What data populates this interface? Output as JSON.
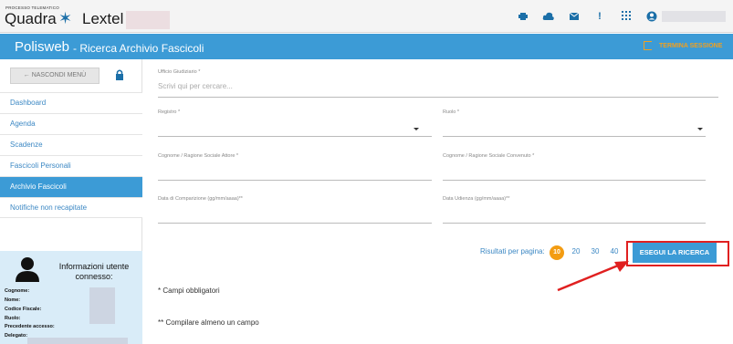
{
  "logo": {
    "tagline": "PROCESSO TELEMATICO",
    "part1": "Quadra",
    "star": "✶",
    "part2": "Lextel"
  },
  "header": {
    "app_name": "Polisweb",
    "page_title": "- Ricerca Archivio Fascicoli",
    "logout_label": "TERMINA SESSIONE"
  },
  "toolbar_icons": [
    "cube-icon",
    "cloud-icon",
    "mail-icon",
    "alert-icon",
    "apps-grid-icon",
    "user-icon"
  ],
  "sidebar": {
    "hide_menu_label": "← NASCONDI MENÙ",
    "items": [
      {
        "label": "Dashboard",
        "active": false
      },
      {
        "label": "Agenda",
        "active": false
      },
      {
        "label": "Scadenze",
        "active": false
      },
      {
        "label": "Fascicoli Personali",
        "active": false
      },
      {
        "label": "Archivio Fascicoli",
        "active": true
      },
      {
        "label": "Notifiche non recapitate",
        "active": false
      }
    ],
    "user_info": {
      "title": "Informazioni utente connesso:",
      "fields": [
        "Cognome:",
        "Nome:",
        "Codice Fiscale:",
        "Ruolo:",
        "Precedente accesso:",
        "Delegato:"
      ]
    }
  },
  "form": {
    "ufficio_label": "Ufficio Giudiziario *",
    "ufficio_placeholder": "Scrivi qui per cercare...",
    "registro_label": "Registro *",
    "ruolo_label": "Ruolo *",
    "attore_label": "Cognome / Ragione Sociale Attore *",
    "convenuto_label": "Cognome / Ragione Sociale Convenuto *",
    "comparizione_label": "Data di Comparizione (gg/mm/aaaa)**",
    "udienza_label": "Data Udienza (gg/mm/aaaa)**"
  },
  "pagination": {
    "label": "Risultati per pagina:",
    "options": [
      "10",
      "20",
      "30",
      "40"
    ],
    "selected": "10"
  },
  "search_button_label": "ESEGUI LA RICERCA",
  "notes": {
    "required": "* Campi obbligatori",
    "at_least_one": "** Compilare almeno un campo"
  },
  "colors": {
    "primary": "#3c9bd6",
    "accent": "#f39c12",
    "highlight": "#e02020"
  }
}
